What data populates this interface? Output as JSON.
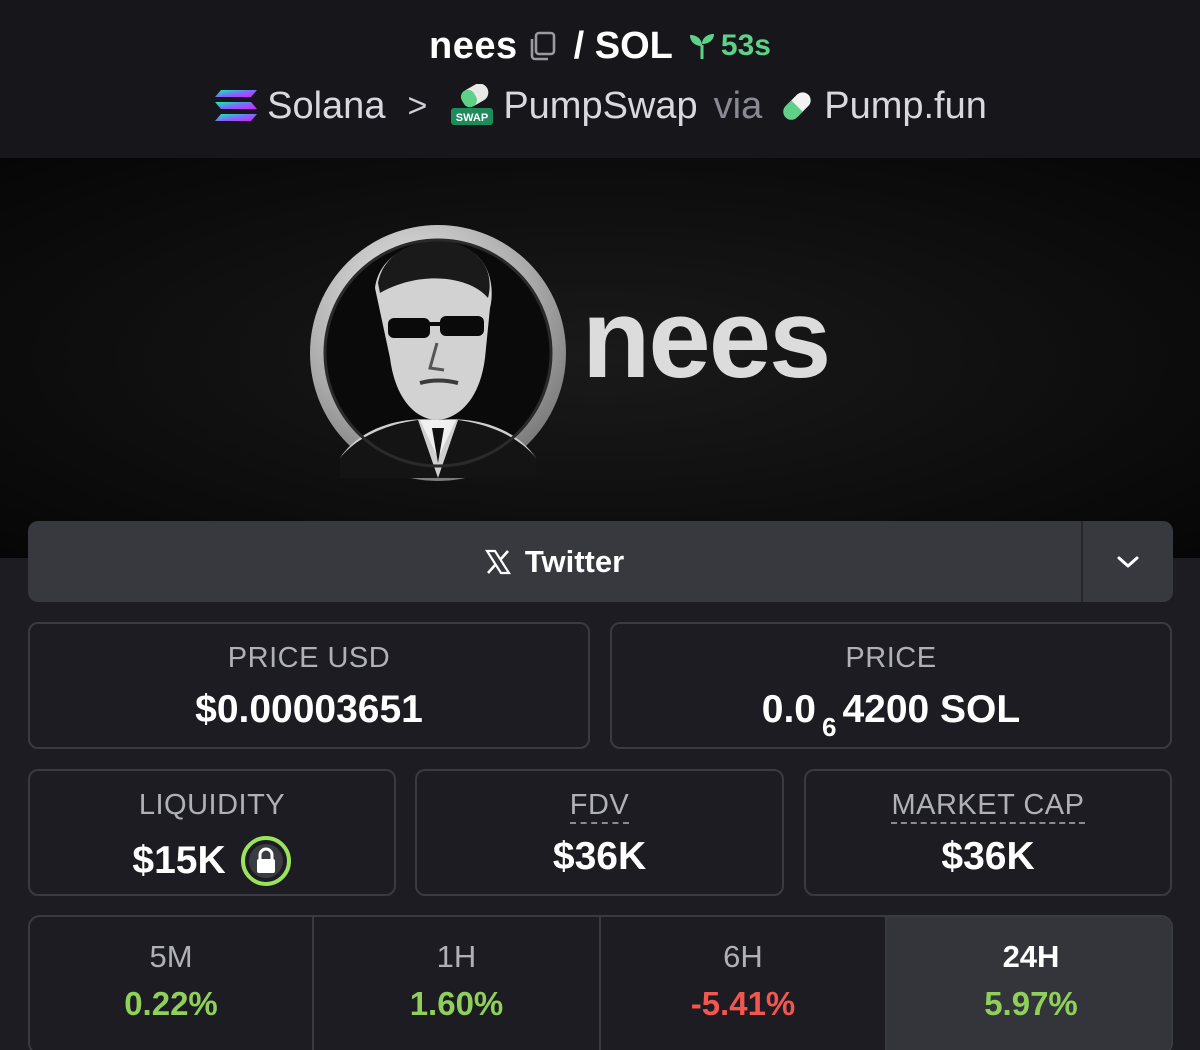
{
  "header": {
    "token": "nees",
    "pair_separator": "/ SOL",
    "age": "53s",
    "chain": "Solana",
    "chain_separator": ">",
    "dex": "PumpSwap",
    "dex_badge": "SWAP",
    "via": "via",
    "launchpad": "Pump.fun"
  },
  "banner": {
    "logo_text": "nees"
  },
  "twitter": {
    "label": "Twitter"
  },
  "stats": {
    "price_usd": {
      "label": "PRICE USD",
      "value": "$0.00003651"
    },
    "price": {
      "label": "PRICE",
      "prefix": "0.0",
      "zeros": "6",
      "suffix": "4200 SOL"
    },
    "liquidity": {
      "label": "LIQUIDITY",
      "value": "$15K"
    },
    "fdv": {
      "label": "FDV",
      "value": "$36K"
    },
    "market_cap": {
      "label": "MARKET CAP",
      "value": "$36K"
    }
  },
  "changes": [
    {
      "label": "5M",
      "value": "0.22%"
    },
    {
      "label": "1H",
      "value": "1.60%"
    },
    {
      "label": "6H",
      "value": "-5.41%"
    },
    {
      "label": "24H",
      "value": "5.97%"
    }
  ],
  "colors": {
    "positive": "#8fd05a",
    "negative": "#f2564f",
    "age_green": "#5fd088",
    "background": "#1c1c22"
  }
}
